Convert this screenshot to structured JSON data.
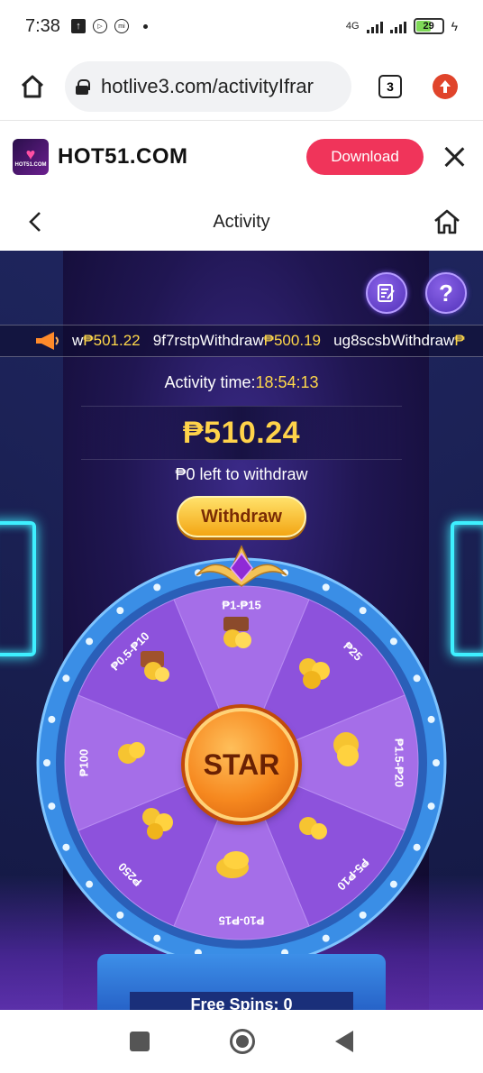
{
  "status_bar": {
    "time": "7:38",
    "network": "4G",
    "battery": "29",
    "icons": [
      "upload-notification-icon",
      "play-store-icon",
      "mi-icon"
    ]
  },
  "browser": {
    "url": "hotlive3.com/activityIfrar",
    "tab_count": "3"
  },
  "app_banner": {
    "name": "HOT51.COM",
    "logo_text": "HOT51.COM",
    "download_label": "Download"
  },
  "header": {
    "title": "Activity"
  },
  "game": {
    "ticker": [
      {
        "user": "w",
        "action": "",
        "amount": "₱501.22"
      },
      {
        "user": "9f7rstp",
        "action": "Withdraw",
        "amount": "₱500.19"
      },
      {
        "user": "ug8scsb",
        "action": "Withdraw",
        "amount": "₱"
      }
    ],
    "activity_label": "Activity time:",
    "activity_time": "18:54:13",
    "amount": "₱510.24",
    "left_to_withdraw": "₱0 left to withdraw",
    "withdraw_label": "Withdraw",
    "star_label": "STAR",
    "free_spins": "Free Spins: 0",
    "wheel_segments": [
      "₱1-₱15",
      "₱25",
      "₱1.5-₱20",
      "₱5-₱10",
      "₱10-₱15",
      "₱250",
      "₱100",
      "₱0.5-₱10"
    ]
  },
  "colors": {
    "accent_download": "#f0345a",
    "amount_gold": "#ffd34a",
    "wheel_purple": "#9b5de5",
    "wheel_rim": "#3a8ee6"
  }
}
